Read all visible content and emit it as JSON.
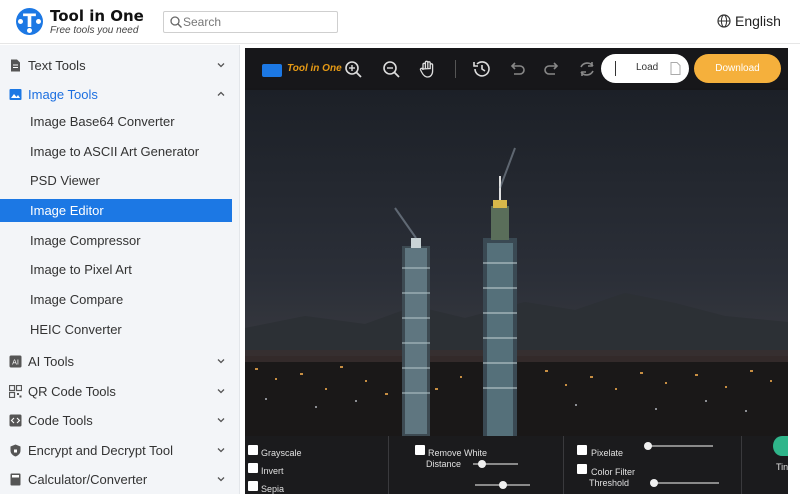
{
  "header": {
    "brand_title": "Tool in One",
    "brand_subtitle": "Free tools you need",
    "search_placeholder": "Search",
    "language": "English"
  },
  "sidebar": {
    "categories": [
      {
        "label": "Text Tools",
        "icon": "document-icon",
        "expanded": false
      },
      {
        "label": "Image Tools",
        "icon": "image-icon",
        "expanded": true
      },
      {
        "label": "AI Tools",
        "icon": "ai-icon",
        "expanded": false
      },
      {
        "label": "QR Code Tools",
        "icon": "qr-code-icon",
        "expanded": false
      },
      {
        "label": "Code Tools",
        "icon": "code-icon",
        "expanded": false
      },
      {
        "label": "Encrypt and Decrypt Tool",
        "icon": "shield-icon",
        "expanded": false
      },
      {
        "label": "Calculator/Converter",
        "icon": "calculator-icon",
        "expanded": false
      }
    ],
    "image_tools": [
      "Image Base64 Converter",
      "Image to ASCII Art Generator",
      "PSD Viewer",
      "Image Editor",
      "Image Compressor",
      "Image to Pixel Art",
      "Image Compare",
      "HEIC Converter"
    ],
    "selected_tool": "Image Editor"
  },
  "editor": {
    "toolbar_brand": "Tool in One",
    "load_label": "Load",
    "download_label": "Download",
    "filters": {
      "grayscale": "Grayscale",
      "invert": "Invert",
      "sepia": "Sepia",
      "remove_white": "Remove White",
      "distance": "Distance",
      "pixelate": "Pixelate",
      "color_filter": "Color Filter",
      "threshold": "Threshold",
      "tint_partial": "Tin"
    },
    "slider_levels": {
      "distance": 0.2,
      "pixelate": 0.05,
      "threshold": 0.05,
      "bottom": 0.5
    }
  },
  "colors": {
    "accent": "#1c78e4",
    "download": "#f5b03c",
    "sidebar_bg": "#f3f5f8",
    "editor_bg": "#2f2f31",
    "controls_bg": "#1b1b1d"
  }
}
